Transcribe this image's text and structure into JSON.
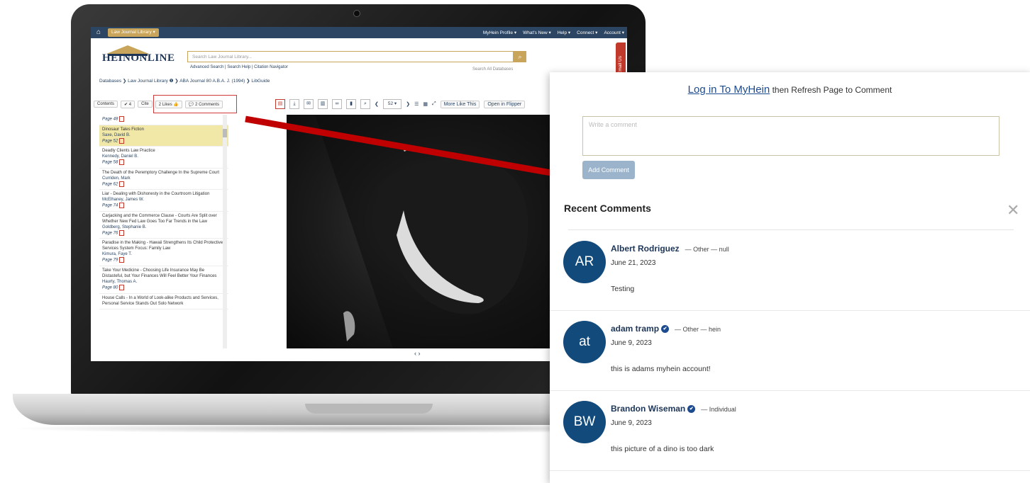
{
  "topnav": {
    "library_menu": "Law Journal Library ▾",
    "items": [
      "MyHein Profile ▾",
      "What's New ▾",
      "Help ▾",
      "Connect ▾",
      "Account ▾"
    ]
  },
  "header": {
    "logo": "HEINONLINE",
    "search_placeholder": "Search Law Journal Library...",
    "search_links": "Advanced Search | Search Help | Citation Navigator",
    "search_all": "Search All Databases",
    "email_tab": "Email Us"
  },
  "breadcrumb": "Databases ❯ Law Journal Library ❶ ❯ ABA Journal 80 A.B.A. J. (1994) ❯ LibGuide",
  "contents_toolbar": {
    "contents": "Contents",
    "count": "4",
    "cite": "Cite",
    "likes": "2 Likes",
    "comments": "2 Comments"
  },
  "viewer_toolbar": {
    "page_number": "52",
    "more_like_this": "More Like This",
    "open_in_flipper": "Open in Flipper"
  },
  "toc": [
    {
      "title": "",
      "author": "",
      "page": "Page 48"
    },
    {
      "title": "Dinosaur Tales Fiction",
      "author": "Saxe, David B.",
      "page": "Page 52",
      "selected": true
    },
    {
      "title": "Deadly Clients Law Practice",
      "author": "Kennedy, Daniel B.",
      "page": "Page 58"
    },
    {
      "title": "The Death of the Peremptory Challenge In the Supreme Court",
      "author": "Curriden, Mark",
      "page": "Page 62"
    },
    {
      "title": "Liar - Dealing with Dishonesty in the Courtroom Litigation",
      "author": "McElhaney, James W.",
      "page": "Page 74"
    },
    {
      "title": "Carjacking and the Commerce Clause - Courts Are Split over Whether New Fed Law Goes Too Far Trends in the Law",
      "author": "Goldberg, Stephanie B.",
      "page": "Page 76"
    },
    {
      "title": "Paradise in the Making - Hawaii Strengthens Its Child Protective Services System Focus: Family Law",
      "author": "Kimura, Faye T.",
      "page": "Page 79"
    },
    {
      "title": "Take Your Medicine - Choosing Life Insurance May Be Distasteful, but Your Finances Will Feel Better Your Finances",
      "author": "Haurty, Thomas A.",
      "page": "Page 80"
    },
    {
      "title": "House Calls - In a World of Look-alike Products and Services, Personal Service Stands Out Solo Network",
      "author": "",
      "page": ""
    }
  ],
  "panel": {
    "login_link": "Log in To MyHein",
    "login_suffix": " then Refresh Page to Comment",
    "comment_placeholder": "Write a comment",
    "add_comment": "Add Comment",
    "recent_heading": "Recent Comments",
    "close_glyph": "✕",
    "comments": [
      {
        "initials": "AR",
        "name": "Albert Rodriguez",
        "verified": false,
        "meta": "—  Other  —  null",
        "date": "June 21, 2023",
        "text": "Testing"
      },
      {
        "initials": "at",
        "name": "adam tramp",
        "verified": true,
        "meta": "—  Other  —  hein",
        "date": "June 9, 2023",
        "text": "this is adams myhein account!"
      },
      {
        "initials": "BW",
        "name": "Brandon Wiseman",
        "verified": true,
        "meta": "—  Individual",
        "date": "June 9, 2023",
        "text": "this picture of a dino is too dark"
      }
    ]
  },
  "colors": {
    "nav": "#2b4563",
    "accent_gold": "#c8a55a",
    "avatar": "#124a7c",
    "arrow": "#c00000",
    "button": "#9bb4cb"
  }
}
